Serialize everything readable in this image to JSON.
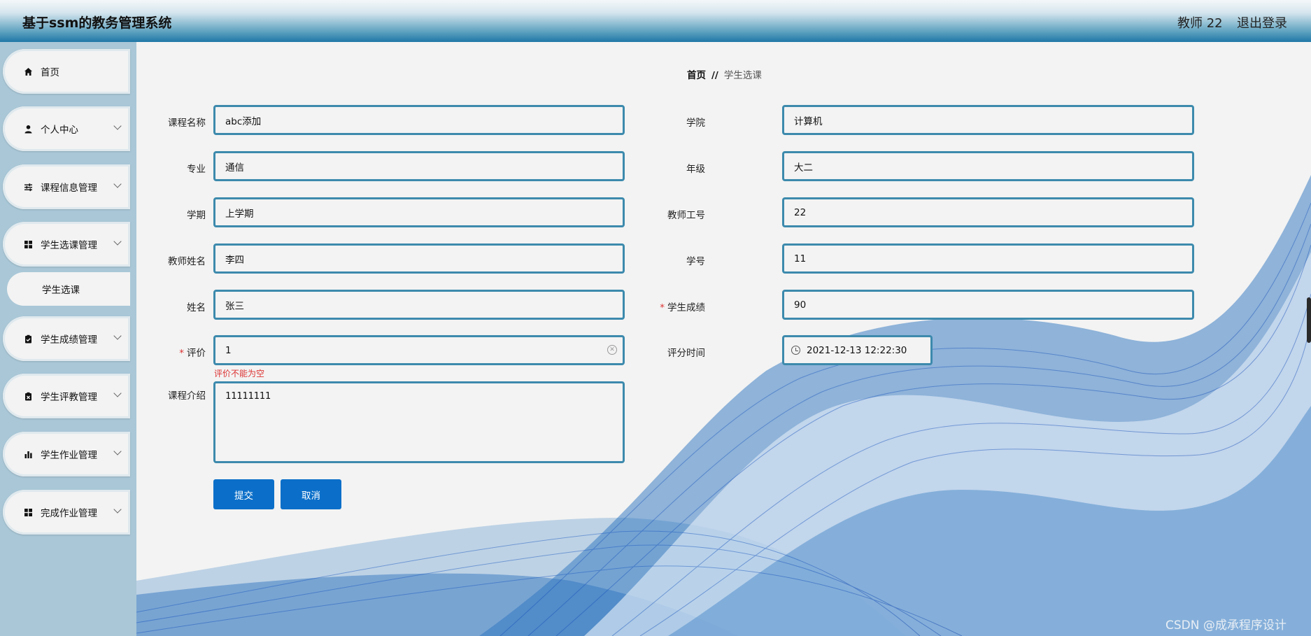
{
  "header": {
    "title": "基于ssm的教务管理系统",
    "user": "教师 22",
    "logout": "退出登录"
  },
  "sidebar": {
    "items": [
      {
        "label": "首页",
        "icon": "home-icon"
      },
      {
        "label": "个人中心",
        "icon": "user-icon"
      },
      {
        "label": "课程信息管理",
        "icon": "sliders-icon"
      },
      {
        "label": "学生选课管理",
        "icon": "grid-icon"
      },
      {
        "label": "学生成绩管理",
        "icon": "clipboard-check-icon"
      },
      {
        "label": "学生评教管理",
        "icon": "clipboard-x-icon"
      },
      {
        "label": "学生作业管理",
        "icon": "bar-chart-icon"
      },
      {
        "label": "完成作业管理",
        "icon": "grid-icon"
      }
    ],
    "sub_item": "学生选课"
  },
  "breadcrumb": {
    "home": "首页",
    "separator": "//",
    "current": "学生选课"
  },
  "form": {
    "course_name": {
      "label": "课程名称",
      "value": "abc添加"
    },
    "major": {
      "label": "专业",
      "value": "通信"
    },
    "semester": {
      "label": "学期",
      "value": "上学期"
    },
    "teacher_name": {
      "label": "教师姓名",
      "value": "李四"
    },
    "student_name": {
      "label": "姓名",
      "value": "张三"
    },
    "evaluation": {
      "label": "评价",
      "value": "1",
      "error": "评价不能为空"
    },
    "course_intro": {
      "label": "课程介绍",
      "value": "11111111"
    },
    "college": {
      "label": "学院",
      "value": "计算机"
    },
    "grade": {
      "label": "年级",
      "value": "大二"
    },
    "teacher_id": {
      "label": "教师工号",
      "value": "22"
    },
    "student_id": {
      "label": "学号",
      "value": "11"
    },
    "score": {
      "label": "学生成绩",
      "value": "90"
    },
    "eval_time": {
      "label": "评分时间",
      "value": "2021-12-13 12:22:30"
    },
    "required_mark": "*"
  },
  "buttons": {
    "submit": "提交",
    "cancel": "取消"
  },
  "watermark": "CSDN @成承程序设计",
  "colors": {
    "field_border": "#3d8aad",
    "button": "#0b6fc9",
    "sidebar": "#a9c7d7",
    "error": "#dd3333"
  }
}
